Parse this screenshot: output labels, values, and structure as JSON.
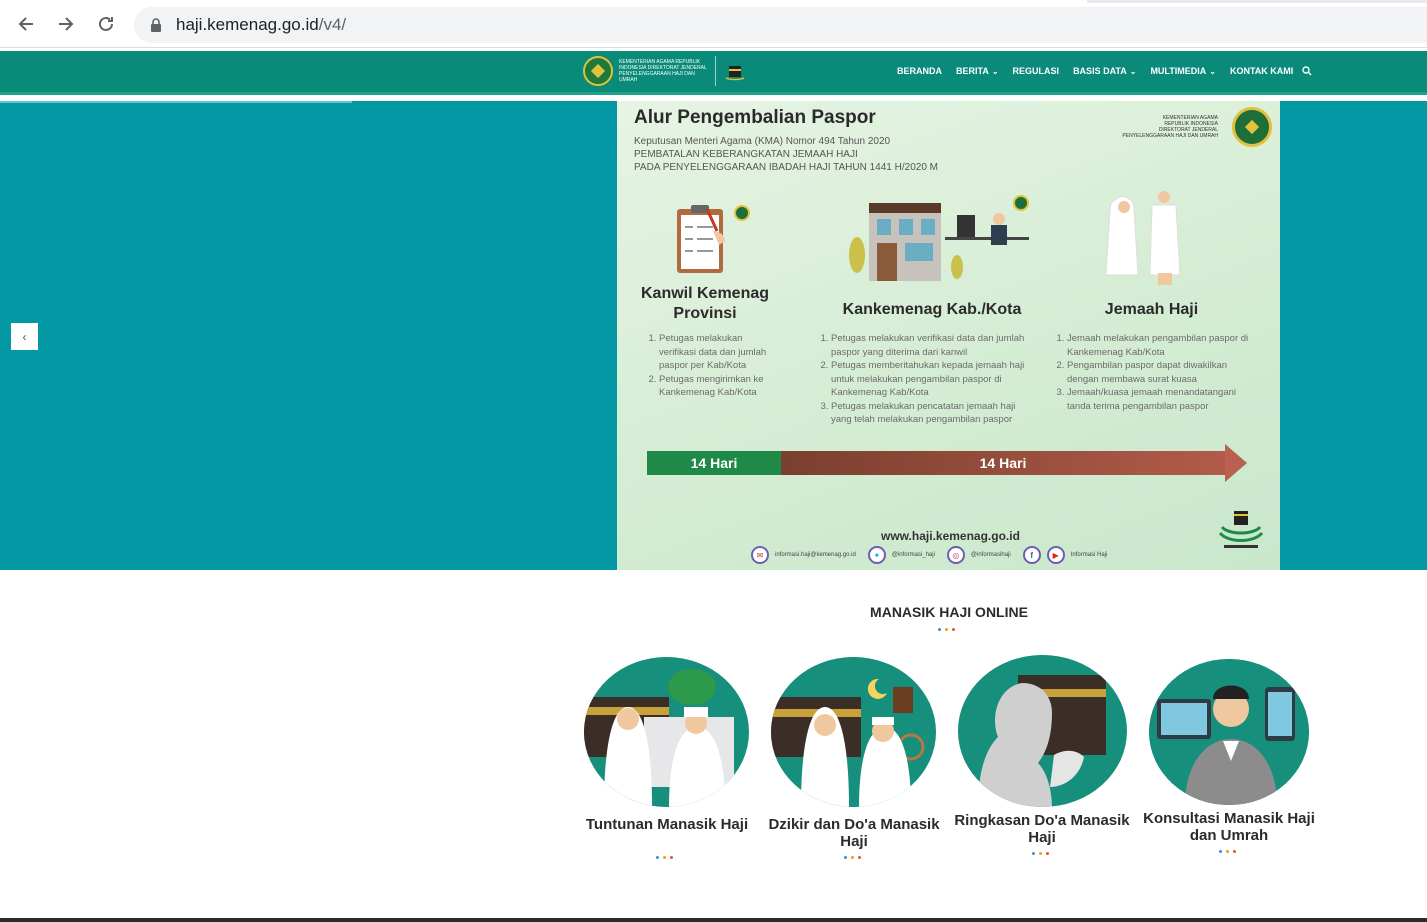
{
  "browser": {
    "url_host": "haji.kemenag.go.id",
    "url_path": "/v4/"
  },
  "site": {
    "logo_text": "KEMENTERIAN AGAMA REPUBLIK INDONESIA DIREKTORAT JENDERAL PENYELENGGARAAN HAJI DAN UMRAH",
    "nav": [
      {
        "label": "BERANDA",
        "dropdown": false
      },
      {
        "label": "BERITA",
        "dropdown": true
      },
      {
        "label": "REGULASI",
        "dropdown": false
      },
      {
        "label": "BASIS DATA",
        "dropdown": true
      },
      {
        "label": "MULTIMEDIA",
        "dropdown": true
      },
      {
        "label": "KONTAK KAMI",
        "dropdown": false
      }
    ],
    "accent": "#0a8a78",
    "hero_bg": "#0497a4"
  },
  "slide": {
    "title": "Alur Pengembalian Paspor",
    "subtitle_lines": [
      "Keputusan Menteri Agama (KMA) Nomor 494 Tahun 2020",
      "PEMBATALAN KEBERANGKATAN JEMAAH HAJI",
      "PADA PENYELENGGARAAN IBADAH HAJI TAHUN 1441 H/2020 M"
    ],
    "agency_lines": [
      "KEMENTERIAN AGAMA",
      "REPUBLIK INDONESIA",
      "DIREKTORAT JENDERAL",
      "PENYELENGGARAAN HAJI DAN UMRAH"
    ],
    "columns": [
      {
        "title": "Kanwil Kemenag Provinsi",
        "items": [
          "Petugas melakukan verifikasi data dan jumlah paspor per Kab/Kota",
          "Petugas mengirimkan ke Kankemenag Kab/Kota"
        ]
      },
      {
        "title": "Kankemenag Kab./Kota",
        "items": [
          "Petugas melakukan verifikasi data dan jumlah paspor yang diterima dari kanwil",
          "Petugas memberitahukan kepada jemaah haji untuk melakukan pengambilan paspor di Kankemenag Kab/Kota",
          "Petugas melakukan pencatatan jemaah haji yang telah melakukan pengambilan paspor"
        ]
      },
      {
        "title": "Jemaah Haji",
        "items": [
          "Jemaah melakukan pengambilan paspor di Kankemenag Kab/Kota",
          "Pengambilan paspor dapat diwakilkan dengan membawa surat kuasa",
          "Jemaah/kuasa jemaah menandatangani tanda terima pengambilan paspor"
        ]
      }
    ],
    "flow_first": "14 Hari",
    "flow_second": "14 Hari",
    "website": "www.haji.kemenag.go.id",
    "socials": [
      {
        "icon": "email-icon",
        "label": "informasi.haji@kemenag.go.id"
      },
      {
        "icon": "twitter-icon",
        "label": "@informasi_haji"
      },
      {
        "icon": "instagram-icon",
        "label": "@informasihaji"
      },
      {
        "icon": "facebook-icon",
        "label": ""
      },
      {
        "icon": "youtube-icon",
        "label": "Informasi Haji"
      }
    ]
  },
  "manasik": {
    "title": "MANASIK HAJI ONLINE",
    "cards": [
      {
        "label": "Tuntunan Manasik Haji"
      },
      {
        "label": "Dzikir dan Do'a Manasik Haji"
      },
      {
        "label": "Ringkasan Do'a Manasik Haji"
      },
      {
        "label": "Konsultasi Manasik Haji dan Umrah"
      }
    ],
    "dot_colors": [
      "#3b8fd9",
      "#e8a020",
      "#e0553a"
    ]
  }
}
